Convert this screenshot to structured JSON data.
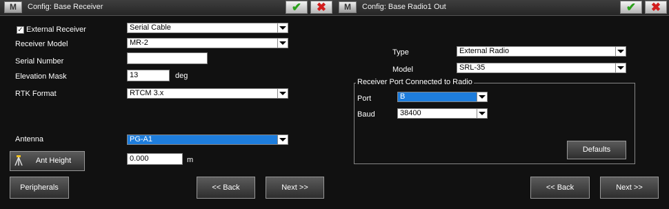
{
  "left": {
    "title": "Config: Base Receiver",
    "m_label": "M",
    "external_receiver": {
      "label": "External Receiver",
      "checked": true
    },
    "connection_value": "Serial Cable",
    "receiver_model": {
      "label": "Receiver Model",
      "value": "MR-2"
    },
    "serial_number": {
      "label": "Serial Number",
      "value": ""
    },
    "elevation_mask": {
      "label": "Elevation Mask",
      "value": "13",
      "unit": "deg"
    },
    "rtk_format": {
      "label": "RTK Format",
      "value": "RTCM 3.x"
    },
    "antenna": {
      "label": "Antenna",
      "value": "PG-A1"
    },
    "ant_height": {
      "button": "Ant Height",
      "value": "0.000",
      "unit": "m"
    },
    "buttons": {
      "peripherals": "Peripherals",
      "back": "<< Back",
      "next": "Next >>"
    }
  },
  "right": {
    "title": "Config: Base Radio1 Out",
    "m_label": "M",
    "type": {
      "label": "Type",
      "value": "External Radio"
    },
    "model": {
      "label": "Model",
      "value": "SRL-35"
    },
    "group_title": "Receiver Port Connected to Radio",
    "port": {
      "label": "Port",
      "value": "B"
    },
    "baud": {
      "label": "Baud",
      "value": "38400"
    },
    "buttons": {
      "defaults": "Defaults",
      "back": "<< Back",
      "next": "Next >>"
    }
  },
  "icons": {
    "ok": "checkmark-icon",
    "cancel": "red-x-icon",
    "ant": "tripod-icon"
  },
  "colors": {
    "selection": "#1e7ddc",
    "ok": "#2aa01a",
    "cancel": "#d21d1d"
  }
}
